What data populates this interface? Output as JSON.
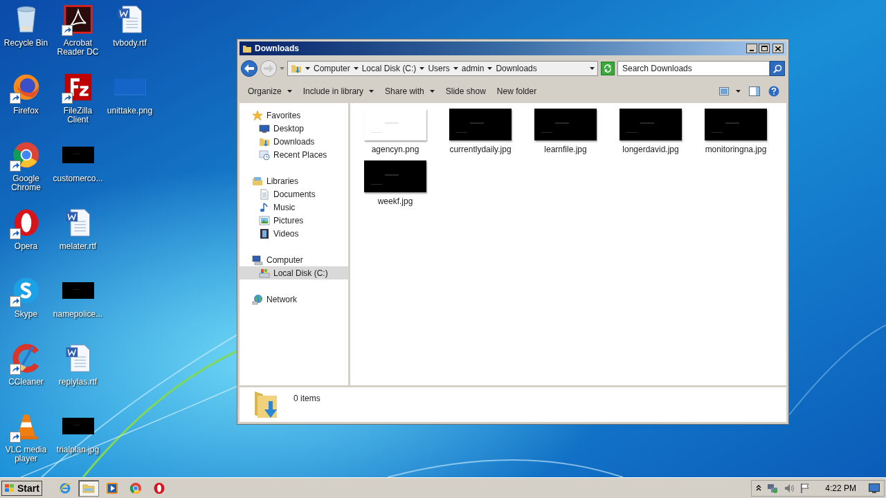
{
  "desktop": {
    "icons": [
      {
        "label": "Recycle Bin",
        "kind": "recycle",
        "shortcut": false
      },
      {
        "label": "Firefox",
        "kind": "firefox",
        "shortcut": true
      },
      {
        "label": "Google Chrome",
        "kind": "chrome",
        "shortcut": true
      },
      {
        "label": "Opera",
        "kind": "opera",
        "shortcut": true
      },
      {
        "label": "Skype",
        "kind": "skype",
        "shortcut": true
      },
      {
        "label": "CCleaner",
        "kind": "ccleaner",
        "shortcut": true
      },
      {
        "label": "VLC media player",
        "kind": "vlc",
        "shortcut": true
      },
      {
        "label": "Acrobat Reader DC",
        "kind": "acrobat",
        "shortcut": true
      },
      {
        "label": "FileZilla Client",
        "kind": "filezilla",
        "shortcut": true
      },
      {
        "label": "customerco...",
        "kind": "picture",
        "shortcut": false
      },
      {
        "label": "melater.rtf",
        "kind": "word",
        "shortcut": false
      },
      {
        "label": "namepolice...",
        "kind": "picture",
        "shortcut": false
      },
      {
        "label": "replylas.rtf",
        "kind": "word",
        "shortcut": false
      },
      {
        "label": "trialplan.jpg",
        "kind": "picture",
        "shortcut": false
      },
      {
        "label": "tvbody.rtf",
        "kind": "word",
        "shortcut": false
      },
      {
        "label": "unittake.png",
        "kind": "blank",
        "shortcut": false
      }
    ]
  },
  "window": {
    "title": "Downloads",
    "address": [
      "Computer",
      "Local Disk (C:)",
      "Users",
      "admin",
      "Downloads"
    ],
    "search": {
      "placeholder": "Search Downloads"
    },
    "toolbar": [
      {
        "label": "Organize",
        "menu": true
      },
      {
        "label": "Include in library",
        "menu": true
      },
      {
        "label": "Share with",
        "menu": true
      },
      {
        "label": "Slide show",
        "menu": false
      },
      {
        "label": "New folder",
        "menu": false
      }
    ],
    "nav": [
      {
        "label": "Favorites",
        "kind": "star",
        "selected": false,
        "children": [
          {
            "label": "Desktop",
            "kind": "desktop",
            "selected": false
          },
          {
            "label": "Downloads",
            "kind": "downloads",
            "selected": false
          },
          {
            "label": "Recent Places",
            "kind": "recent",
            "selected": false
          }
        ]
      },
      {
        "label": "Libraries",
        "kind": "library",
        "selected": false,
        "children": [
          {
            "label": "Documents",
            "kind": "documents",
            "selected": false
          },
          {
            "label": "Music",
            "kind": "music",
            "selected": false
          },
          {
            "label": "Pictures",
            "kind": "pictures",
            "selected": false
          },
          {
            "label": "Videos",
            "kind": "videos",
            "selected": false
          }
        ]
      },
      {
        "label": "Computer",
        "kind": "computer",
        "selected": false,
        "children": [
          {
            "label": "Local Disk (C:)",
            "kind": "disk",
            "selected": true
          }
        ]
      },
      {
        "label": "Network",
        "kind": "network",
        "selected": false
      }
    ],
    "files": [
      {
        "name": "agencyn.png",
        "kind": "blank"
      },
      {
        "name": "currentlydaily.jpg"
      },
      {
        "name": "learnfile.jpg"
      },
      {
        "name": "longerdavid.jpg"
      },
      {
        "name": "monitoringna.jpg"
      },
      {
        "name": "weekf.jpg"
      }
    ],
    "details": {
      "count": "0 items"
    }
  },
  "taskbar": {
    "start": "Start",
    "apps": [
      {
        "kind": "ie",
        "selected": false
      },
      {
        "kind": "explorer",
        "selected": true
      },
      {
        "kind": "media",
        "selected": false
      },
      {
        "kind": "chrome",
        "selected": false
      },
      {
        "kind": "opera",
        "selected": false
      }
    ],
    "clock": "4:22 PM"
  }
}
